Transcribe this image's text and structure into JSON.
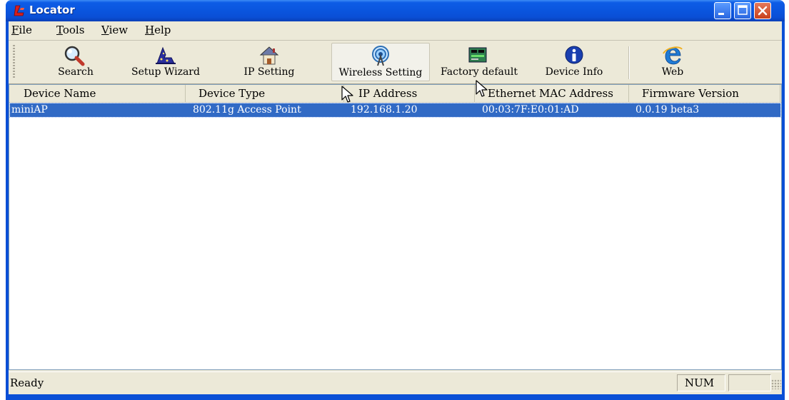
{
  "window": {
    "title": "Locator"
  },
  "menu": [
    {
      "label": "File",
      "mnemonic": "F",
      "rest": "ile"
    },
    {
      "label": "Tools",
      "mnemonic": "T",
      "rest": "ools"
    },
    {
      "label": "View",
      "mnemonic": "V",
      "rest": "iew"
    },
    {
      "label": "Help",
      "mnemonic": "H",
      "rest": "elp"
    }
  ],
  "toolbar": {
    "search": {
      "label": "Search",
      "icon": "magnifier-icon"
    },
    "setup_wizard": {
      "label": "Setup Wizard",
      "icon": "wizard-hat-icon"
    },
    "ip_setting": {
      "label": "IP Setting",
      "icon": "house-icon"
    },
    "wireless_setting": {
      "label": "Wireless Setting",
      "icon": "wireless-antenna-icon"
    },
    "factory_default": {
      "label": "Factory default",
      "icon": "circuit-board-icon"
    },
    "device_info": {
      "label": "Device Info",
      "icon": "info-icon"
    },
    "web": {
      "label": "Web",
      "icon": "internet-explorer-icon"
    }
  },
  "table": {
    "columns": [
      "Device Name",
      "Device Type",
      "IP Address",
      "Ethernet MAC Address",
      "Firmware Version"
    ],
    "rows": [
      [
        "miniAP",
        "802.11g Access Point",
        "192.168.1.20",
        "00:03:7F:E0:01:AD",
        "0.0.19 beta3"
      ]
    ]
  },
  "status": {
    "text": "Ready",
    "num": "NUM"
  },
  "colors": {
    "titlebar": "#0a4fd6",
    "selection": "#316ac5",
    "face": "#ece9d8"
  }
}
